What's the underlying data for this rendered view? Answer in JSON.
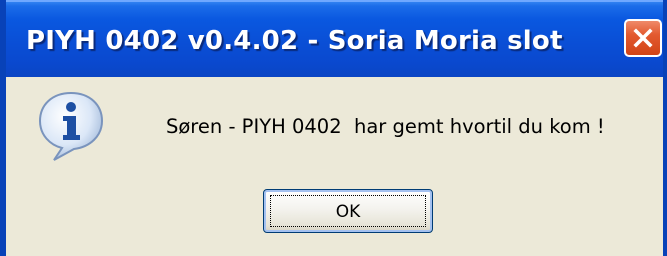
{
  "dialog": {
    "title": "PIYH 0402 v0.4.02 - Soria Moria slot",
    "message": "Søren - PIYH 0402  har gemt hvortil du kom !",
    "ok_label": "OK",
    "icon": "info-icon",
    "close_icon": "close-icon"
  },
  "colors": {
    "titlebar": "#0a58e0",
    "frame": "#0842b8",
    "body": "#ece9d8",
    "close_button": "#e35a30"
  }
}
